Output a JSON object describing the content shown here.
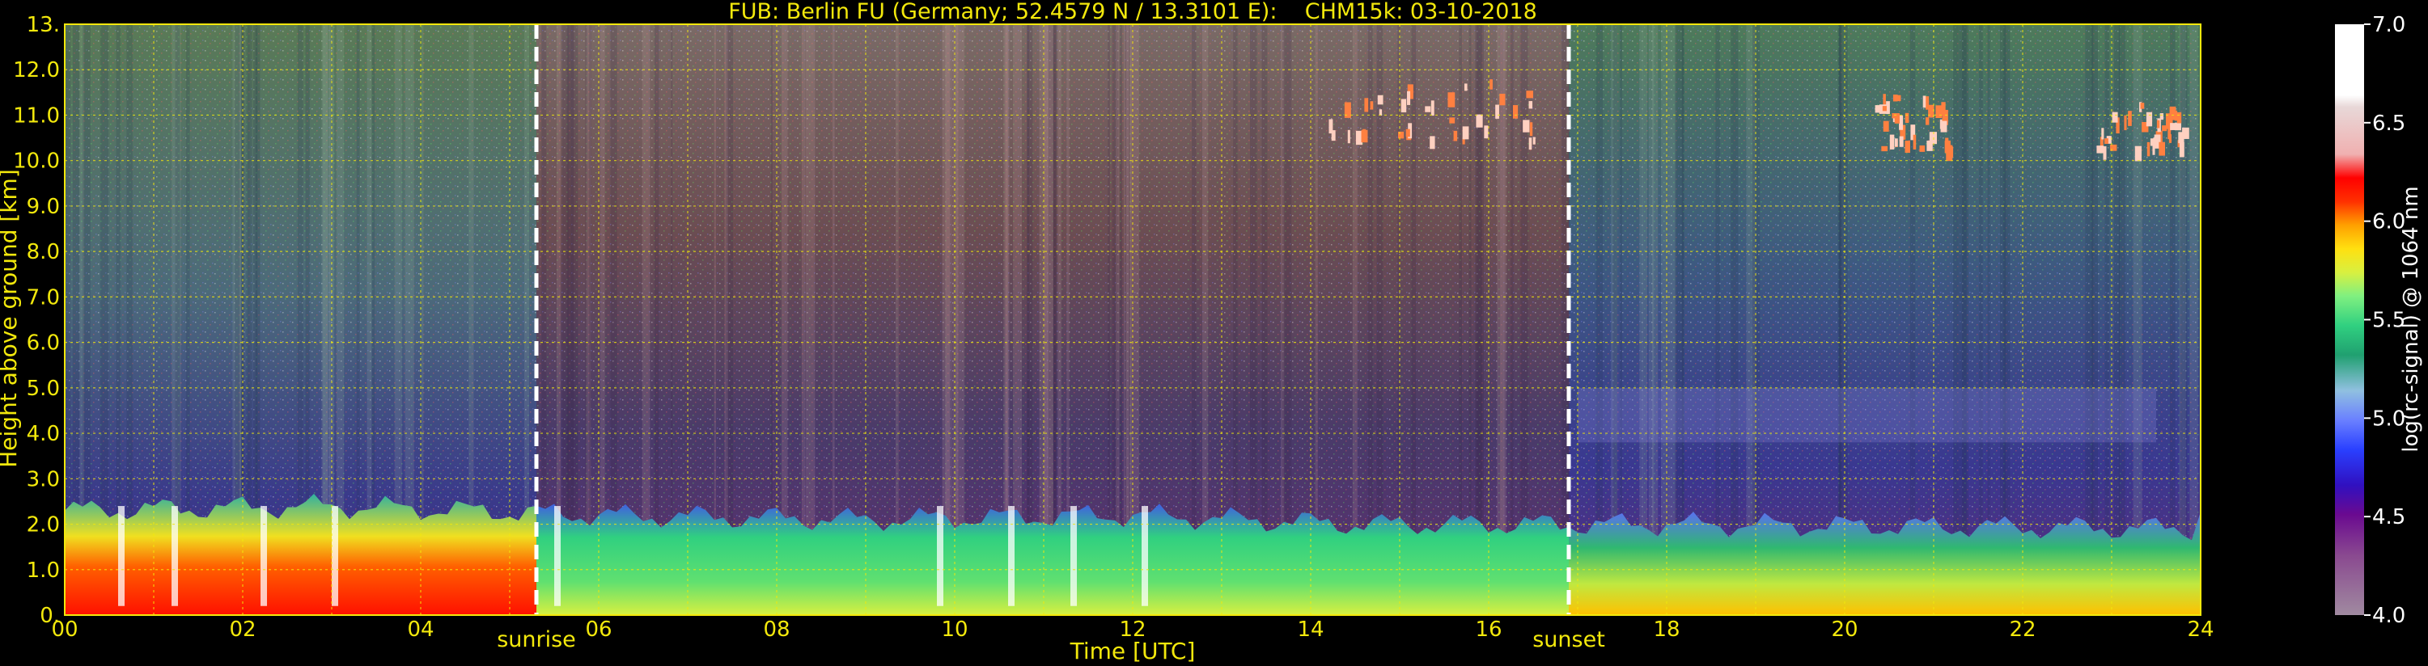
{
  "chart_data": {
    "type": "heatmap",
    "title": "FUB: Berlin FU (Germany; 52.4579 N / 13.3101 E):    CHM15k: 03-10-2018",
    "xlabel": "Time [UTC]",
    "ylabel": "Height above ground [km]",
    "xlim": [
      0,
      24
    ],
    "ylim": [
      0,
      13
    ],
    "x_ticks": [
      "00",
      "02",
      "04",
      "06",
      "08",
      "10",
      "12",
      "14",
      "16",
      "18",
      "20",
      "22",
      "24"
    ],
    "y_ticks": [
      "0.",
      "1.0",
      "2.0",
      "3.0",
      "4.0",
      "5.0",
      "6.0",
      "7.0",
      "8.0",
      "9.0",
      "10.0",
      "11.0",
      "12.0",
      "13."
    ],
    "grid": true,
    "colorbar": {
      "label": "log(rc-signal) @ 1064 nm",
      "range": [
        4.0,
        7.0
      ],
      "ticks": [
        "4.0",
        "4.5",
        "5.0",
        "5.5",
        "6.0",
        "6.5",
        "7.0"
      ]
    },
    "markers": [
      {
        "name": "sunrise",
        "time": 5.3
      },
      {
        "name": "sunset",
        "time": 16.9
      }
    ],
    "features": {
      "boundary_layer_top_km": [
        {
          "time": 0,
          "height": 2.3
        },
        {
          "time": 3,
          "height": 2.4
        },
        {
          "time": 6,
          "height": 2.2
        },
        {
          "time": 9,
          "height": 2.1
        },
        {
          "time": 12,
          "height": 2.2
        },
        {
          "time": 14.5,
          "height": 2.0
        },
        {
          "time": 18,
          "height": 2.0
        },
        {
          "time": 24,
          "height": 1.9
        }
      ],
      "cirrus_layers": [
        {
          "t_start": 14.2,
          "t_end": 16.5,
          "h_bottom": 10.5,
          "h_top": 11.8
        },
        {
          "t_start": 20.3,
          "t_end": 21.2,
          "h_bottom": 10.3,
          "h_top": 11.5
        },
        {
          "t_start": 22.8,
          "t_end": 23.8,
          "h_bottom": 10.3,
          "h_top": 11.3
        }
      ],
      "aerosol_layer": {
        "t_start": 17.0,
        "t_end": 23.5,
        "h_bottom": 3.8,
        "h_top": 5.0
      }
    }
  }
}
